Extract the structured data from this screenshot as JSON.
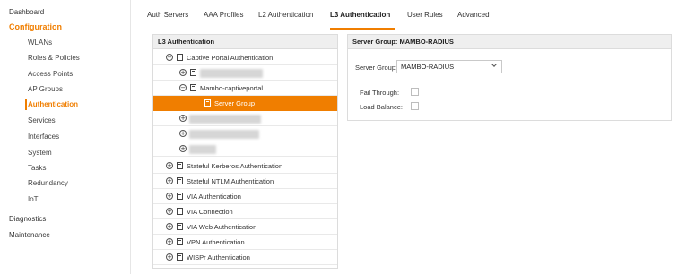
{
  "sidebar": {
    "dashboard": "Dashboard",
    "configuration": "Configuration",
    "items": [
      {
        "label": "WLANs"
      },
      {
        "label": "Roles & Policies"
      },
      {
        "label": "Access Points"
      },
      {
        "label": "AP Groups"
      },
      {
        "label": "Authentication"
      },
      {
        "label": "Services"
      },
      {
        "label": "Interfaces"
      },
      {
        "label": "System"
      },
      {
        "label": "Tasks"
      },
      {
        "label": "Redundancy"
      },
      {
        "label": "IoT"
      }
    ],
    "diagnostics": "Diagnostics",
    "maintenance": "Maintenance",
    "active_item": "Authentication"
  },
  "tabs": [
    {
      "label": "Auth Servers"
    },
    {
      "label": "AAA Profiles"
    },
    {
      "label": "L2 Authentication"
    },
    {
      "label": "L3 Authentication"
    },
    {
      "label": "User Rules"
    },
    {
      "label": "Advanced"
    }
  ],
  "active_tab": "L3 Authentication",
  "tree": {
    "header": "L3 Authentication",
    "rows": [
      {
        "label": "Captive Portal Authentication",
        "toggle": "⊖"
      },
      {
        "label": "",
        "toggle": "⊕"
      },
      {
        "label": "Mambo-captiveportal",
        "toggle": "⊖"
      },
      {
        "label": "Server Group",
        "selected": true
      },
      {
        "label": "",
        "toggle": "⊕"
      },
      {
        "label": "",
        "toggle": "⊕"
      },
      {
        "label": "",
        "toggle": "⊕"
      },
      {
        "label": "Stateful Kerberos Authentication",
        "toggle": "⊕"
      },
      {
        "label": "Stateful NTLM Authentication",
        "toggle": "⊕"
      },
      {
        "label": "VIA Authentication",
        "toggle": "⊕"
      },
      {
        "label": "VIA Connection",
        "toggle": "⊕"
      },
      {
        "label": "VIA Web Authentication",
        "toggle": "⊕"
      },
      {
        "label": "VPN Authentication",
        "toggle": "⊕"
      },
      {
        "label": "WISPr Authentication",
        "toggle": "⊕"
      }
    ]
  },
  "server_group_panel": {
    "header": "Server Group: MAMBO-RADIUS",
    "server_group_label": "Server Group:",
    "server_group_value": "MAMBO-RADIUS",
    "fail_through_label": "Fail Through:",
    "fail_through_checked": false,
    "load_balance_label": "Load Balance:",
    "load_balance_checked": false
  },
  "colors": {
    "accent": "#f07e00",
    "header_bg": "#efefef",
    "border": "#dcdcdc"
  },
  "icons": {
    "collapse": "minus-circle-icon",
    "expand": "plus-circle-icon",
    "profile": "document-icon",
    "dropdown": "chevron-down-icon"
  }
}
